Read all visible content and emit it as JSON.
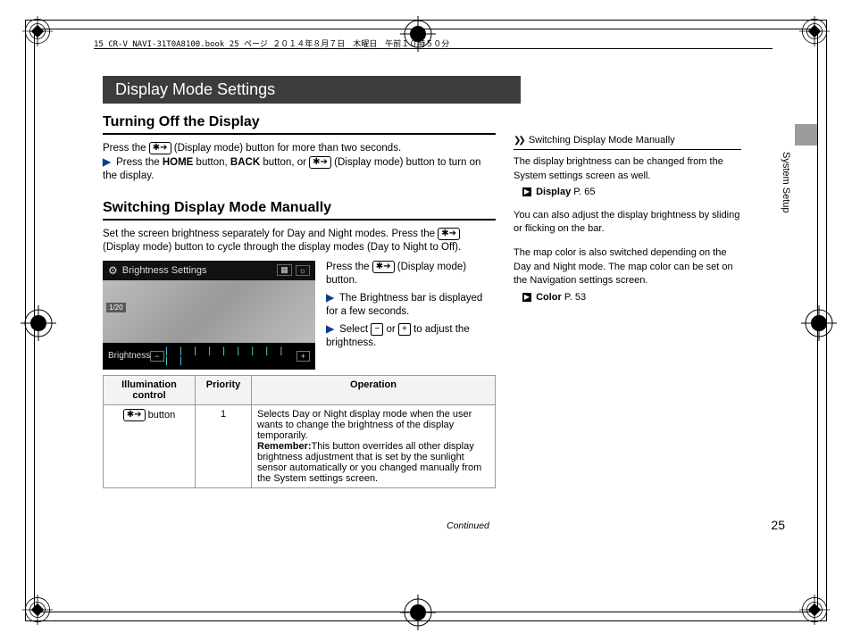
{
  "header": {
    "source_line": "15 CR-V NAVI-31T0A8100.book  25 ページ  ２０１４年８月７日　木曜日　午前１０時５０分"
  },
  "title_bar": "Display Mode Settings",
  "section1": {
    "title": "Turning Off the Display",
    "line1_a": "Press the ",
    "line1_icon": "✱➔",
    "line1_b": " (Display mode) button for more than two seconds.",
    "line2_a": "Press the ",
    "home": "HOME",
    "line2_b": " button, ",
    "back": "BACK",
    "line2_c": " button, or ",
    "line2_icon": "✱➔",
    "line2_d": " (Display mode) button to turn on the display."
  },
  "section2": {
    "title": "Switching Display Mode Manually",
    "intro_a": "Set the screen brightness separately for Day and Night modes. Press the ",
    "intro_icon": "✱➔",
    "intro_b": " (Display mode) button to cycle through the display modes (Day to Night to Off).",
    "screenshot": {
      "header": "Brightness Settings",
      "date": "1/20",
      "footer_label": "Brightness",
      "footer_minus": "−",
      "footer_plus": "+",
      "bars": "| | | | | | | | | | |"
    },
    "steps": {
      "a1": "Press the ",
      "a_icon": "✱➔",
      "a2": " (Display mode) button.",
      "b": "The Brightness bar is displayed for a few seconds.",
      "c1": "Select ",
      "minus": "−",
      "c2": " or ",
      "plus": "+",
      "c3": " to adjust the brightness."
    }
  },
  "table": {
    "h1": "Illumination control",
    "h2": "Priority",
    "h3": "Operation",
    "row1": {
      "icon": "✱➔",
      "control": " button",
      "priority": "1",
      "op1": "Selects Day or Night display mode when the user wants to change the brightness of the display temporarily.",
      "remember_label": "Remember:",
      "op2": "This button overrides all other display brightness adjustment that is set by the sunlight sensor automatically or you changed manually from the System settings screen."
    }
  },
  "sidebar": {
    "title": "Switching Display Mode Manually",
    "p1": "The display brightness can be changed from the System settings screen as well.",
    "link1_label": "Display",
    "link1_page": "P. 65",
    "p2": "You can also adjust the display brightness by sliding or flicking on the bar.",
    "p3": "The map color is also switched depending on the Day and Night mode. The map color can be set on the Navigation settings screen.",
    "link2_label": "Color",
    "link2_page": "P. 53"
  },
  "footer": {
    "continued": "Continued",
    "page": "25",
    "section_tab": "System Setup"
  }
}
